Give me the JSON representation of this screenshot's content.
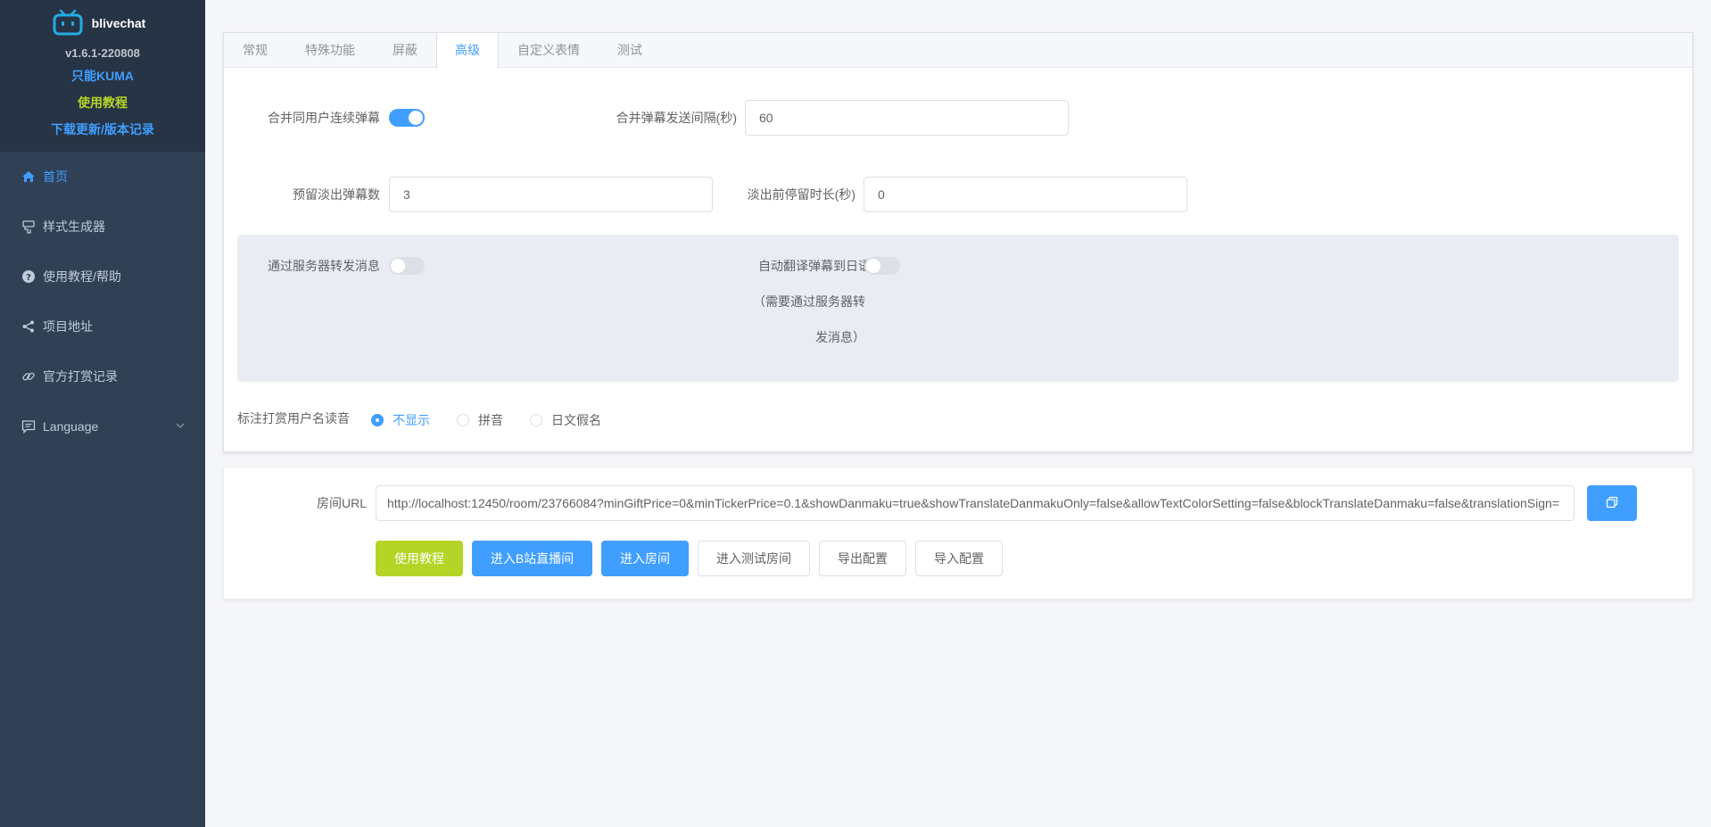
{
  "sidebar": {
    "brand": "blivechat",
    "version": "v1.6.1-220808",
    "links": {
      "kuma": "只能KUMA",
      "tutorial": "使用教程",
      "download": "下载更新/版本记录"
    },
    "menu": {
      "home": "首页",
      "style_gen": "样式生成器",
      "help": "使用教程/帮助",
      "project": "项目地址",
      "donations": "官方打赏记录",
      "language": "Language"
    }
  },
  "tabs": {
    "general": "常规",
    "special": "特殊功能",
    "block": "屏蔽",
    "advanced": "高级",
    "emoticons": "自定义表情",
    "test": "测试"
  },
  "form": {
    "merge_label": "合并同用户连续弹幕",
    "merge_enabled": true,
    "merge_interval_label": "合并弹幕发送间隔(秒)",
    "merge_interval_value": "60",
    "reserve_label": "预留淡出弹幕数",
    "reserve_value": "3",
    "fade_label": "淡出前停留时长(秒)",
    "fade_value": "0",
    "relay_label": "通过服务器转发消息",
    "relay_enabled": false,
    "translate_label": "自动翻译弹幕到日语",
    "translate_enabled": false,
    "translate_note_line1": "（需要通过服务器转",
    "translate_note_line2": "发消息）",
    "reading_label": "标注打赏用户名读音",
    "reading_options": {
      "none": "不显示",
      "pinyin": "拼音",
      "kana": "日文假名"
    },
    "reading_selected": "none"
  },
  "room": {
    "url_label": "房间URL",
    "url_value": "http://localhost:12450/room/23766084?minGiftPrice=0&minTickerPrice=0.1&showDanmaku=true&showTranslateDanmakuOnly=false&allowTextColorSetting=false&blockTranslateDanmaku=false&translationSign=",
    "buttons": {
      "tutorial": "使用教程",
      "enter_bili": "进入B站直播间",
      "enter_room": "进入房间",
      "enter_test": "进入测试房间",
      "export": "导出配置",
      "import": "导入配置"
    }
  },
  "colors": {
    "primary": "#409eff",
    "accent_green": "#b5d526",
    "sidebar_bg": "#304156"
  }
}
